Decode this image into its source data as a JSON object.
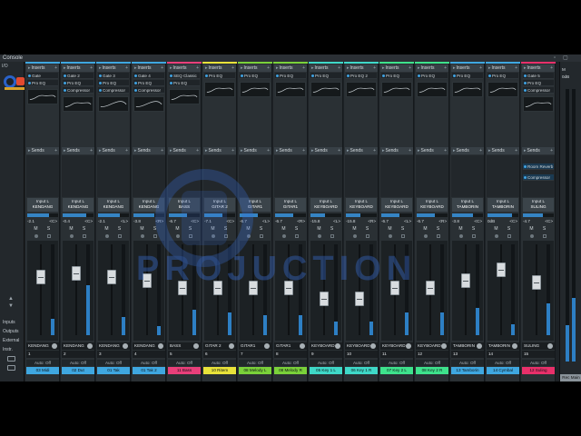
{
  "window": {
    "title": "Console"
  },
  "left_panel": {
    "io_label": "I/O",
    "nav": [
      "Inputs",
      "Outputs",
      "External",
      "Instr."
    ]
  },
  "section_labels": {
    "inserts": "Inserts",
    "sends": "Sends",
    "input": "Input L",
    "auto": "Auto: Off"
  },
  "channels": [
    {
      "num": "1",
      "name": "KENDANG",
      "vol": "-2.1",
      "pan": "<C>",
      "color": "#3fa7e0",
      "track": "03 Midi",
      "plugins": [
        "Gate",
        "Pro EQ"
      ],
      "eq_on": true,
      "meter": 0.18,
      "fader": 0.72
    },
    {
      "num": "2",
      "name": "KENDANG",
      "vol": "-0.4",
      "pan": "<C>",
      "color": "#3fa7e0",
      "track": "02 Dut",
      "plugins": [
        "Gate 2",
        "Pro EQ",
        "Compressor"
      ],
      "eq_on": true,
      "meter": 0.55,
      "fader": 0.76
    },
    {
      "num": "3",
      "name": "KENDANG",
      "vol": "-2.1",
      "pan": "<L>",
      "color": "#3fa7e0",
      "track": "01 Tak",
      "plugins": [
        "Gate 3",
        "Pro EQ",
        "Compressor"
      ],
      "eq_on": false,
      "meter": 0.2,
      "fader": 0.72
    },
    {
      "num": "4",
      "name": "KENDANG",
      "vol": "-3.8",
      "pan": "<R>",
      "color": "#3fa7e0",
      "track": "01 Tak 2",
      "plugins": [
        "Gate 4",
        "Pro EQ",
        "Compressor"
      ],
      "eq_on": false,
      "meter": 0.1,
      "fader": 0.68
    },
    {
      "num": "5",
      "name": "BASS",
      "vol": "-6.7",
      "pan": "<C>",
      "color": "#e83f7a",
      "track": "11 Bass",
      "plugins": [
        "SEQ Classic",
        "Pro EQ"
      ],
      "eq_on": true,
      "meter": 0.28,
      "fader": 0.6
    },
    {
      "num": "6",
      "name": "GITAR 2",
      "vol": "-7.1",
      "pan": "<C>",
      "color": "#e8e23a",
      "track": "10 Ritem",
      "plugins": [
        "Pro EQ"
      ],
      "eq_on": true,
      "meter": 0.25,
      "fader": 0.6
    },
    {
      "num": "7",
      "name": "GITAR1",
      "vol": "-6.7",
      "pan": "<L>",
      "color": "#7ad13a",
      "track": "08 Melody L",
      "plugins": [
        "Pro EQ"
      ],
      "eq_on": true,
      "meter": 0.22,
      "fader": 0.6
    },
    {
      "num": "8",
      "name": "GITAR1",
      "vol": "-6.7",
      "pan": "<R>",
      "color": "#7ad13a",
      "track": "08 Melody R",
      "plugins": [
        "Pro EQ"
      ],
      "eq_on": true,
      "meter": 0.22,
      "fader": 0.6
    },
    {
      "num": "9",
      "name": "KEYBOARD",
      "vol": "-15.8",
      "pan": "<L>",
      "color": "#3fd8c8",
      "track": "05 Key 1 L",
      "plugins": [
        "Pro EQ"
      ],
      "eq_on": true,
      "meter": 0.15,
      "fader": 0.48
    },
    {
      "num": "10",
      "name": "KEYBOARD",
      "vol": "-15.8",
      "pan": "<R>",
      "color": "#3fd8c8",
      "track": "06 Key 1 R",
      "plugins": [
        "Pro EQ 2"
      ],
      "eq_on": true,
      "meter": 0.15,
      "fader": 0.48
    },
    {
      "num": "11",
      "name": "KEYBOARD",
      "vol": "-6.7",
      "pan": "<L>",
      "color": "#3ee28c",
      "track": "07 Key 2 L",
      "plugins": [
        "Pro EQ"
      ],
      "eq_on": true,
      "meter": 0.25,
      "fader": 0.6
    },
    {
      "num": "12",
      "name": "KEYBOARD",
      "vol": "-6.7",
      "pan": "<R>",
      "color": "#3ee28c",
      "track": "08 Key 2 R",
      "plugins": [
        "Pro EQ"
      ],
      "eq_on": true,
      "meter": 0.25,
      "fader": 0.6
    },
    {
      "num": "13",
      "name": "TAMBORIN",
      "vol": "-3.8",
      "pan": "<C>",
      "color": "#3fa7e0",
      "track": "13 Tamborin",
      "plugins": [
        "Pro EQ"
      ],
      "eq_on": true,
      "meter": 0.3,
      "fader": 0.68
    },
    {
      "num": "14",
      "name": "TAMBORIN",
      "vol": "0dB",
      "pan": "<C>",
      "color": "#3fa7e0",
      "track": "14 Cymbal",
      "plugins": [
        "Pro EQ"
      ],
      "eq_on": true,
      "meter": 0.12,
      "fader": 0.8
    },
    {
      "num": "15",
      "name": "SULING",
      "vol": "-4.7",
      "pan": "<C>",
      "color": "#e8306a",
      "track": "12 Suling",
      "plugins": [
        "Gate 5",
        "Pro EQ",
        "Compressor"
      ],
      "eq_on": true,
      "meter": 0.35,
      "fader": 0.66,
      "sends": [
        "Room Reverb",
        "Compressor"
      ]
    }
  ],
  "main": {
    "label": "M",
    "db": "0dB",
    "tag": "Rec Main"
  },
  "watermark": {
    "text": "PROJUCTION"
  }
}
